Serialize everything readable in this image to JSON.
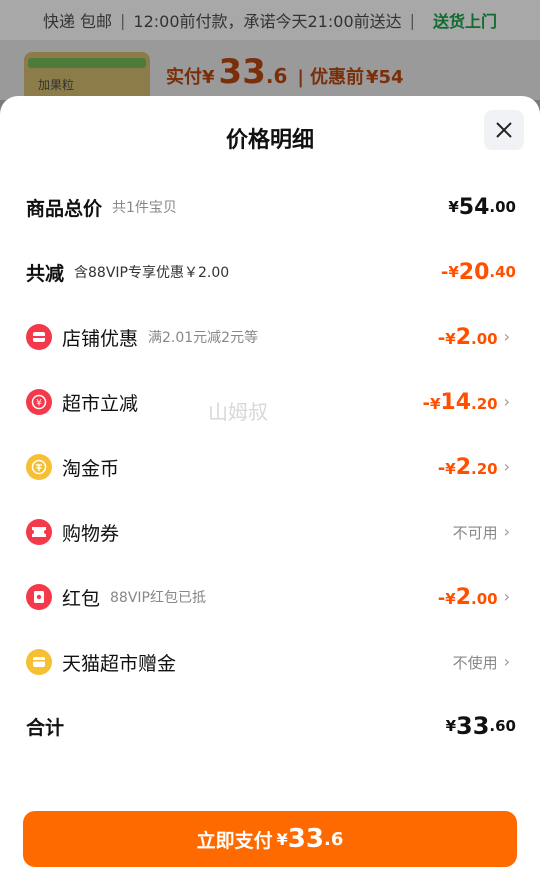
{
  "background": {
    "delivery": "快递 包邮",
    "promise": "12:00前付款，承诺今天21:00前送达",
    "delivery_tag": "送货上门",
    "thumb_text": "加果粒",
    "paid_label": "实付",
    "currency": "¥",
    "paid_int": "33",
    "paid_dec": ".6",
    "before_label": "优惠前",
    "before_amount": "¥54"
  },
  "sheet": {
    "title": "价格明细",
    "watermark": "山姆叔",
    "rows": [
      {
        "label": "商品总价",
        "sub": "共1件宝贝",
        "sign": "",
        "cur": "¥",
        "int": "54",
        "dec": ".00",
        "color": "black"
      },
      {
        "label": "共减",
        "sub": "含88VIP专享优惠￥2.00",
        "sign": "-",
        "cur": "¥",
        "int": "20",
        "dec": ".40",
        "color": "orange"
      },
      {
        "label": "店铺优惠",
        "sub": "满2.01元减2元等",
        "sign": "-",
        "cur": "¥",
        "int": "2",
        "dec": ".00",
        "color": "orange",
        "icon": "shop-coupon-icon"
      },
      {
        "label": "超市立减",
        "sub": "",
        "sign": "-",
        "cur": "¥",
        "int": "14",
        "dec": ".20",
        "color": "orange",
        "icon": "supermarket-discount-icon"
      },
      {
        "label": "淘金币",
        "sub": "",
        "sign": "-",
        "cur": "¥",
        "int": "2",
        "dec": ".20",
        "color": "orange",
        "icon": "gold-coin-icon"
      },
      {
        "label": "购物券",
        "sub": "",
        "status": "不可用",
        "icon": "shopping-voucher-icon"
      },
      {
        "label": "红包",
        "sub": "88VIP红包已抵",
        "sign": "-",
        "cur": "¥",
        "int": "2",
        "dec": ".00",
        "color": "orange",
        "icon": "red-packet-icon"
      },
      {
        "label": "天猫超市赠金",
        "sub": "",
        "status": "不使用",
        "icon": "bonus-money-icon"
      },
      {
        "label": "合计",
        "sub": "",
        "sign": "",
        "cur": "¥",
        "int": "33",
        "dec": ".60",
        "color": "black"
      }
    ],
    "pay_button": {
      "label": "立即支付",
      "cur": "¥",
      "int": "33",
      "dec": ".6"
    }
  },
  "colors": {
    "accent": "#ff5000",
    "button": "#ff6a00",
    "icon_red": "#f43a4a",
    "icon_gold": "#f6c034"
  }
}
